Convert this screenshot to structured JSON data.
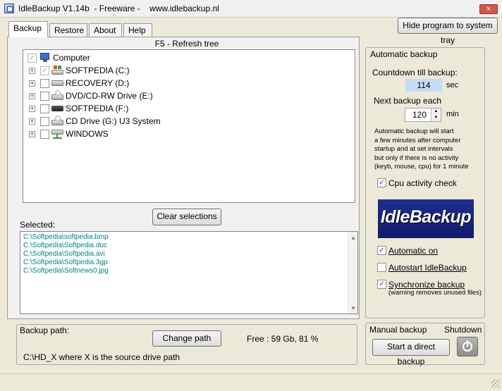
{
  "window": {
    "title": "IdleBackup V1.14b  - Freeware -    www.idlebackup.nl",
    "close_glyph": "×"
  },
  "tabs": [
    {
      "label": "Backup",
      "active": true
    },
    {
      "label": "Restore",
      "active": false
    },
    {
      "label": "About",
      "active": false
    },
    {
      "label": "Help",
      "active": false
    }
  ],
  "toolbar": {
    "hide_label": "Hide program to system tray",
    "refresh_hint": "F5 - Refresh tree"
  },
  "tree": {
    "root": {
      "label": "Computer",
      "checked": true,
      "icon": "computer-icon"
    },
    "items": [
      {
        "label": "SOFTPEDIA (C:)",
        "checked": true,
        "icon": "windows-drive-icon"
      },
      {
        "label": "RECOVERY (D:)",
        "checked": false,
        "icon": "hard-drive-icon"
      },
      {
        "label": "DVD/CD-RW Drive (E:)",
        "checked": false,
        "icon": "cd-drive-icon"
      },
      {
        "label": "SOFTPEDIA (F:)",
        "checked": false,
        "icon": "removable-drive-icon"
      },
      {
        "label": "CD Drive (G:) U3 System",
        "checked": false,
        "icon": "cd-drive-icon"
      },
      {
        "label": "WINDOWS",
        "checked": false,
        "icon": "network-drive-icon"
      }
    ]
  },
  "selection": {
    "clear_label": "Clear selections",
    "label": "Selected:",
    "files": [
      "C:\\Softpedia\\softpedia.bmp",
      "C:\\Softpedia\\Softpedia.doc",
      "C:\\Softpedia\\Softpedia.avi",
      "C:\\Softpedia\\Softpedia.3gp",
      "C:\\Softpedia\\Softnews0.jpg"
    ]
  },
  "backup_path": {
    "title": "Backup path:",
    "change_label": "Change path",
    "free": "Free : 59 Gb, 81 %",
    "hint": "C:\\HD_X  where X is the source drive path"
  },
  "auto_backup": {
    "title": "Automatic backup",
    "countdown_label": "Countdown till backup:",
    "countdown_value": "114",
    "sec": "sec",
    "next_label": "Next backup each",
    "interval_value": "120",
    "min": "min",
    "description": "Automatic backup will start\na few minutes after computer\nstartup and at set intervals\nbut only if there is no activity\n(keyb, mouse, cpu) for 1 minute",
    "cpu_check": {
      "label": "Cpu activity check",
      "checked": true
    },
    "logo_text": "IdleBackup",
    "automatic_on": {
      "label": "Automatic on",
      "checked": true
    },
    "autostart": {
      "label": "Autostart IdleBackup",
      "checked": false
    },
    "synchronize": {
      "label": "Synchronize backup",
      "checked": true
    },
    "sync_note": "(warning removes unused files)"
  },
  "manual": {
    "title": "Manual backup",
    "shutdown_label": "Shutdown",
    "direct_label": "Start a direct backup"
  },
  "colors": {
    "window_bg": "#ece9d8",
    "file_list_text": "#008080",
    "countdown_bg": "#c6dbf4",
    "logo_bg": "#1a2a85"
  }
}
